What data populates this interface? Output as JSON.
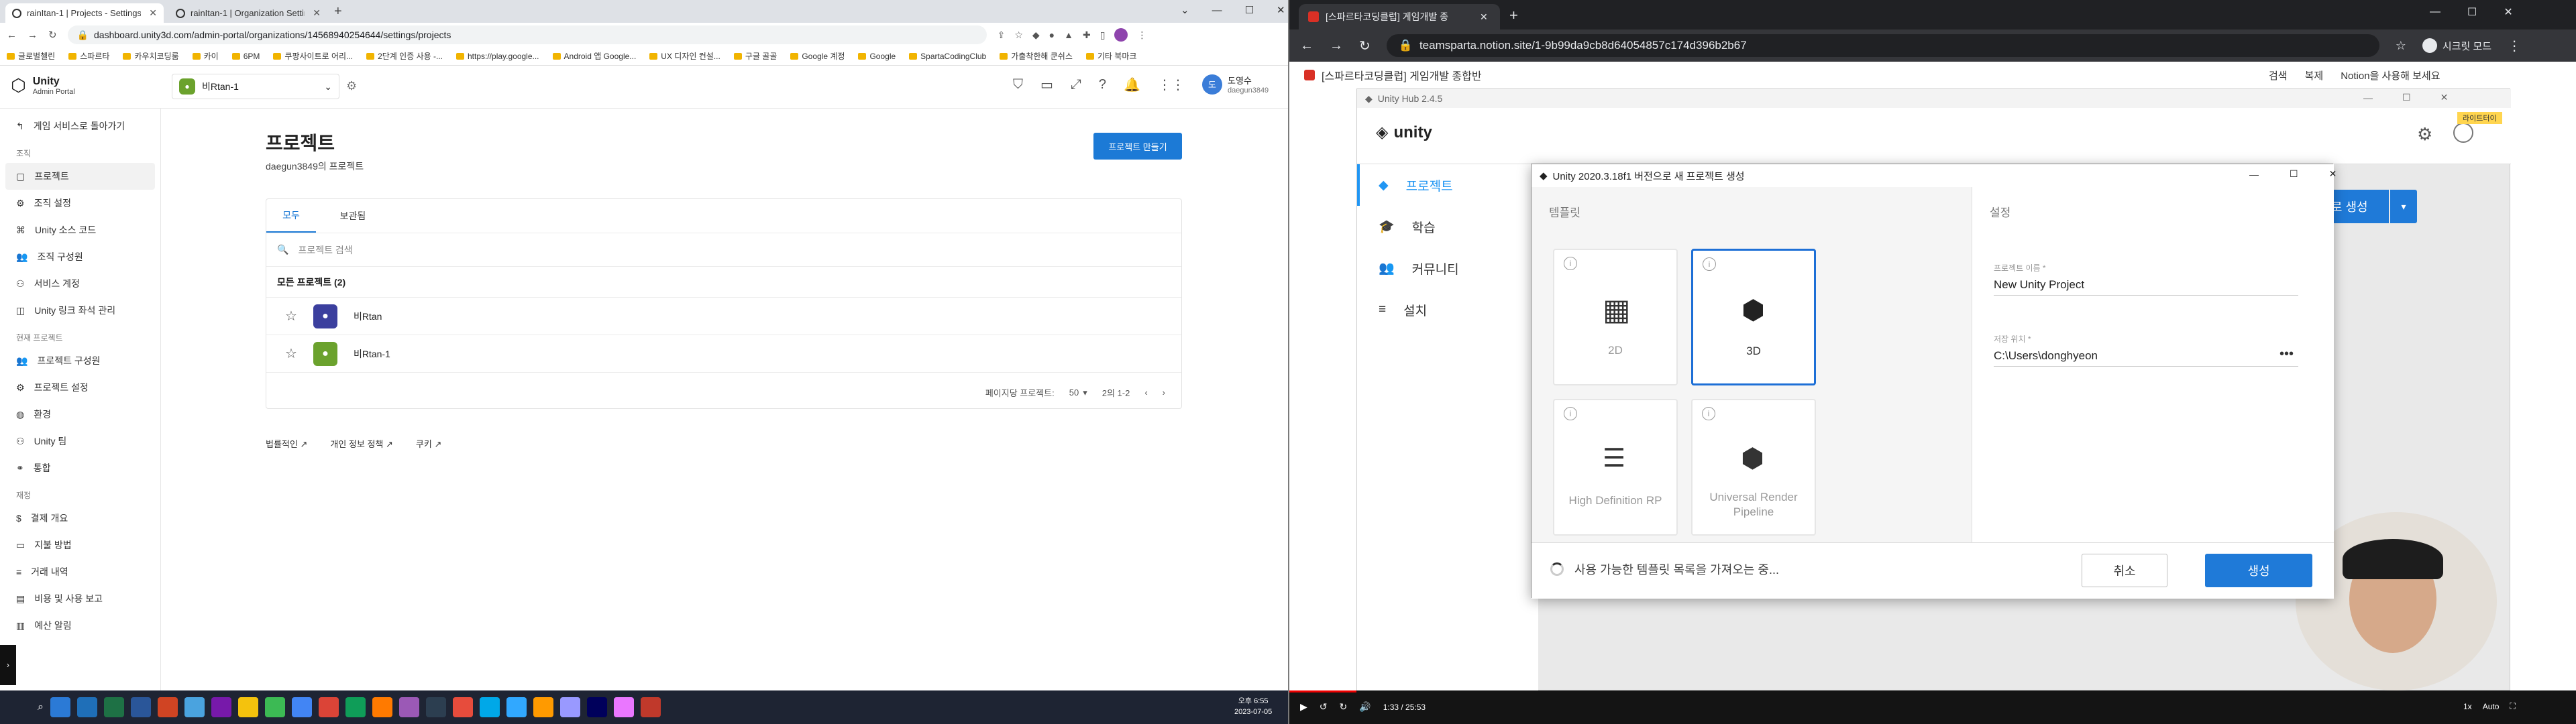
{
  "left_browser": {
    "tabs": [
      {
        "title": "rainItan-1 | Projects - Settings",
        "active": true
      },
      {
        "title": "rainItan-1 | Organization Settin",
        "active": false
      }
    ],
    "new_tab": "+",
    "url": "dashboard.unity3d.com/admin-portal/organizations/14568940254644/settings/projects",
    "bookmarks": [
      "글로벌첼린",
      "스파르타",
      "카우치코딩룸",
      "카이",
      "6PM",
      "쿠팡사이트로 어리...",
      "2단계 인증 사용 -...",
      "https://play.google...",
      "Android 앱 Google...",
      "UX 디자인 컨설...",
      "구글 골골",
      "Google 계정",
      "Google",
      "SpartaCodingClub",
      "가출착한해 쿤쉬스",
      "기타 북마크"
    ],
    "admin": {
      "brand": "Unity",
      "brand_sub": "Admin Portal",
      "project_selector": "비Rtan-1",
      "user_name": "도영수",
      "user_id": "daegun3849",
      "user_initial": "도",
      "back_link": "게임 서비스로 돌아가기",
      "sections": [
        {
          "title": "조직",
          "items": [
            {
              "label": "프로젝트",
              "icon": "folder-icon",
              "active": true
            },
            {
              "label": "조직 설정",
              "icon": "gear-icon"
            },
            {
              "label": "Unity 소스 코드",
              "icon": "code-icon"
            },
            {
              "label": "조직 구성원",
              "icon": "users-icon"
            },
            {
              "label": "서비스 계정",
              "icon": "account-icon"
            },
            {
              "label": "Unity 링크 좌석 관리",
              "icon": "seat-icon"
            }
          ]
        },
        {
          "title": "현재 프로젝트",
          "items": [
            {
              "label": "프로젝트 구성원",
              "icon": "users-icon"
            },
            {
              "label": "프로젝트 설정",
              "icon": "gear-icon"
            },
            {
              "label": "환경",
              "icon": "globe-icon"
            },
            {
              "label": "Unity 팀",
              "icon": "team-icon"
            },
            {
              "label": "통합",
              "icon": "plug-icon"
            }
          ]
        },
        {
          "title": "재정",
          "items": [
            {
              "label": "결제 개요",
              "icon": "dollar-icon"
            },
            {
              "label": "지불 방법",
              "icon": "card-icon"
            },
            {
              "label": "거래 내역",
              "icon": "list-icon"
            },
            {
              "label": "비용 및 사용 보고",
              "icon": "report-icon"
            },
            {
              "label": "예산 알림",
              "icon": "bell-icon"
            }
          ]
        }
      ],
      "page_title": "프로젝트",
      "page_subtitle": "daegun3849의 프로젝트",
      "create_button": "프로젝트 만들기",
      "tabs": [
        "모두",
        "보관됨"
      ],
      "search_placeholder": "프로젝트 검색",
      "list_heading": "모든 프로젝트 (2)",
      "projects": [
        {
          "name": "비Rtan",
          "color": "#3b3f9e"
        },
        {
          "name": "비Rtan-1",
          "color": "#6ba22d"
        }
      ],
      "per_page_label": "페이지당 프로젝트:",
      "per_page_value": "50",
      "range_label": "2의 1-2",
      "footer_links": [
        "법률적인",
        "개인 정보 정책",
        "쿠키"
      ]
    }
  },
  "right_browser": {
    "tab_title": "[스파르타코딩클럽] 게임개발 종",
    "url": "teamsparta.notion.site/1-9b99da9cb8d64054857c174d396b2b67",
    "profile": "시크릿 모드",
    "notion_title": "[스파르타코딩클럽] 게임개발 종합반",
    "notion_actions": [
      "검색",
      "복제",
      "Notion을 사용해 보세요"
    ],
    "hub": {
      "window_title": "Unity Hub 2.4.5",
      "nav": [
        {
          "label": "프로젝트",
          "icon": "cube-icon",
          "active": true
        },
        {
          "label": "학습",
          "icon": "grad-icon"
        },
        {
          "label": "커뮤니티",
          "icon": "community-icon"
        },
        {
          "label": "설치",
          "icon": "list-icon"
        }
      ],
      "new_button": "새로 생성",
      "badge": "라이트터이"
    },
    "dialog": {
      "title": "Unity 2020.3.18f1 버전으로 새 프로젝트 생성",
      "templates_label": "템플릿",
      "templates": [
        {
          "name": "2D",
          "icon": "grid-icon",
          "selected": false
        },
        {
          "name": "3D",
          "icon": "cube-icon",
          "selected": true
        },
        {
          "name": "High Definition RP",
          "icon": "hdrp-icon",
          "selected": false
        },
        {
          "name": "Universal Render Pipeline",
          "icon": "cube-icon",
          "selected": false
        }
      ],
      "settings_label": "설정",
      "project_name_label": "프로젝트 이름 *",
      "project_name_value": "New Unity Project",
      "location_label": "저장 위치 *",
      "location_value": "C:\\Users\\donghyeon",
      "loading_text": "사용 가능한 템플릿 목록을 가져오는 중...",
      "cancel": "취소",
      "create": "생성"
    },
    "video": {
      "time": "1:33 / 25:53",
      "speed": "1x",
      "quality": "Auto"
    }
  },
  "taskbar": {
    "clock_time": "오후 6:55",
    "clock_date": "2023-07-05"
  }
}
